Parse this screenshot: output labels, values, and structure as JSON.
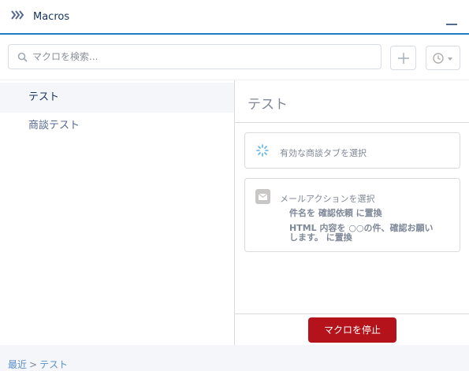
{
  "header": {
    "title": "Macros",
    "icon": "chevron-double-right-icon",
    "minimize_icon": "minimize-icon"
  },
  "search": {
    "placeholder": "マクロを検索..."
  },
  "toolbar": {
    "add_icon": "plus-icon",
    "recent_icon": "clock-icon"
  },
  "macro_list": {
    "items": [
      {
        "label": "テスト",
        "selected": true
      },
      {
        "label": "商談テスト",
        "selected": false
      }
    ]
  },
  "detail": {
    "title": "テスト",
    "steps": [
      {
        "icon": "loading-spinner-icon",
        "label": "有効な商談タブを選択"
      },
      {
        "icon": "email-icon",
        "label": "メールアクションを選択",
        "lines": [
          "件名を 確認依頼 に置換",
          "HTML 内容を ○○の件、確認お願いします。 に置換"
        ]
      }
    ],
    "stop_button": "マクロを停止"
  },
  "footer": {
    "breadcrumb_recent": "最近",
    "breadcrumb_sep": ">",
    "breadcrumb_current": "テスト"
  },
  "colors": {
    "accent": "#1f7dc3",
    "stop_button": "#b5131b",
    "link": "#5b8fc7"
  }
}
